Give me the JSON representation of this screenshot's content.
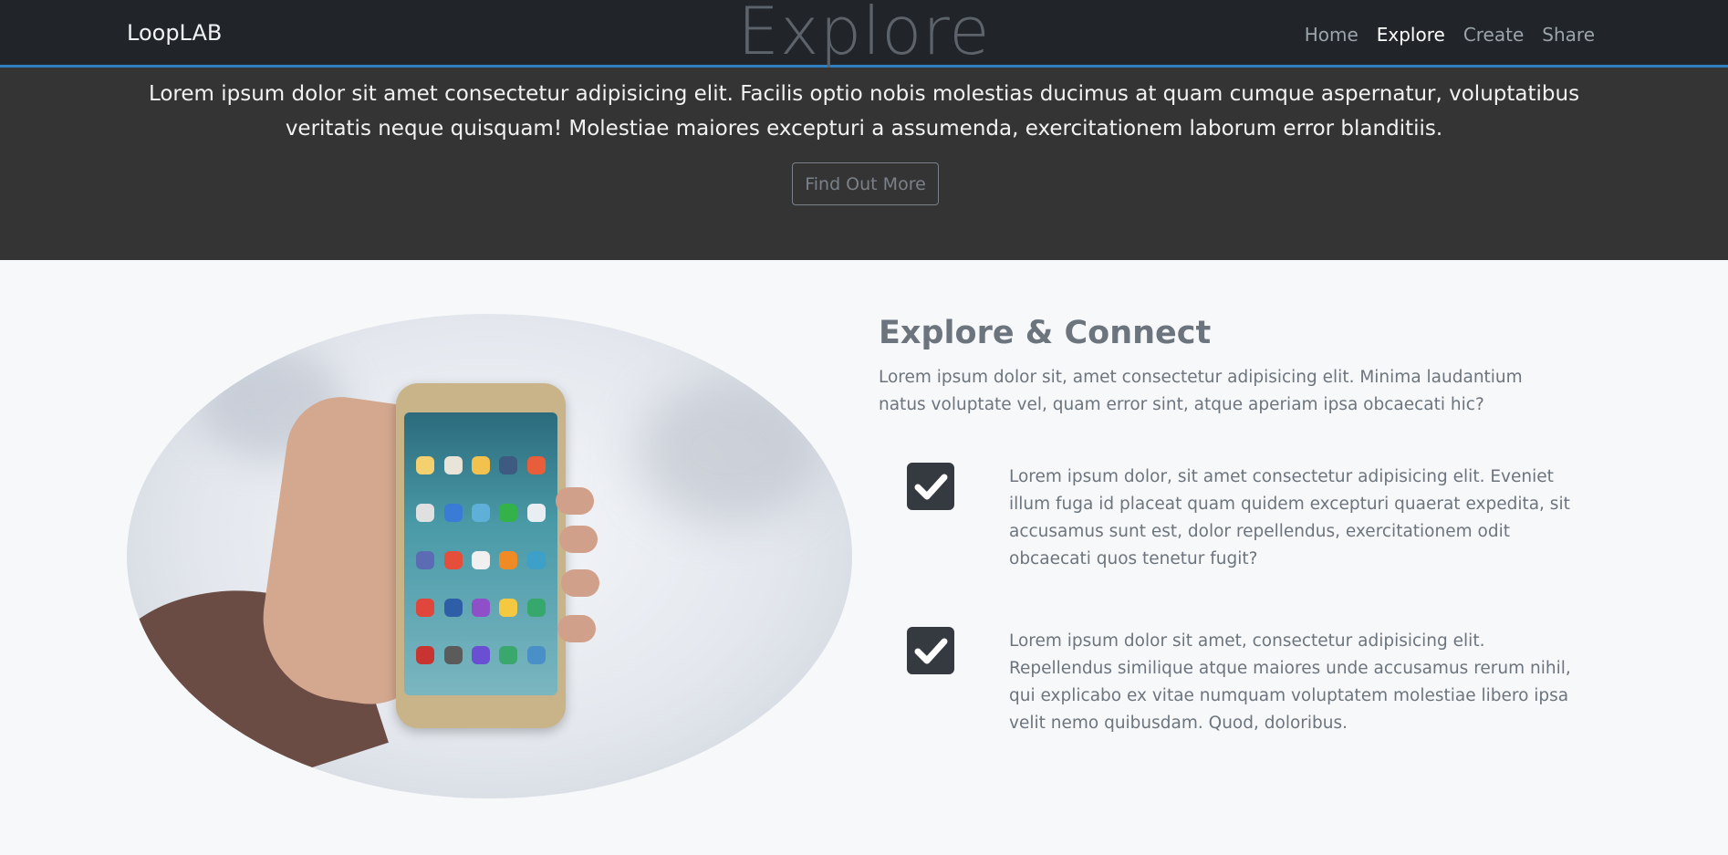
{
  "navbar": {
    "brand": "LoopLAB",
    "title": "Explore",
    "links": [
      {
        "label": "Home"
      },
      {
        "label": "Explore"
      },
      {
        "label": "Create"
      },
      {
        "label": "Share"
      }
    ]
  },
  "hero": {
    "text": "Lorem ipsum dolor sit amet consectetur adipisicing elit. Facilis optio nobis molestias ducimus at quam cumque aspernatur, voluptatibus veritatis neque quisquam! Molestiae maiores excepturi a assumenda, exercitationem laborum error blanditiis.",
    "button_label": "Find Out More"
  },
  "section": {
    "title": "Explore & Connect",
    "intro": "Lorem ipsum dolor sit, amet consectetur adipisicing elit. Minima laudantium natus voluptate vel, quam error sint, atque aperiam ipsa obcaecati hic?",
    "features": [
      {
        "text": "Lorem ipsum dolor, sit amet consectetur adipisicing elit. Eveniet illum fuga id placeat quam quidem excepturi quaerat expedita, sit accusamus sunt est, dolor repellendus, exercitationem odit obcaecati quos tenetur fugit?"
      },
      {
        "text": "Lorem ipsum dolor sit amet, consectetur adipisicing elit. Repellendus similique atque maiores unde accusamus rerum nihil, qui explicabo ex vitae numquam voluptatem molestiae libero ipsa velit nemo quibusdam. Quod, doloribus."
      }
    ]
  },
  "icons": {
    "check": "checkmark-icon"
  },
  "colors": {
    "navbar_bg": "#212529",
    "navbar_border": "#2f7fc1",
    "hero_bg": "#343434",
    "body_bg": "#f7f8fa",
    "muted_text": "#6c757d",
    "check_bg": "#343a40"
  }
}
